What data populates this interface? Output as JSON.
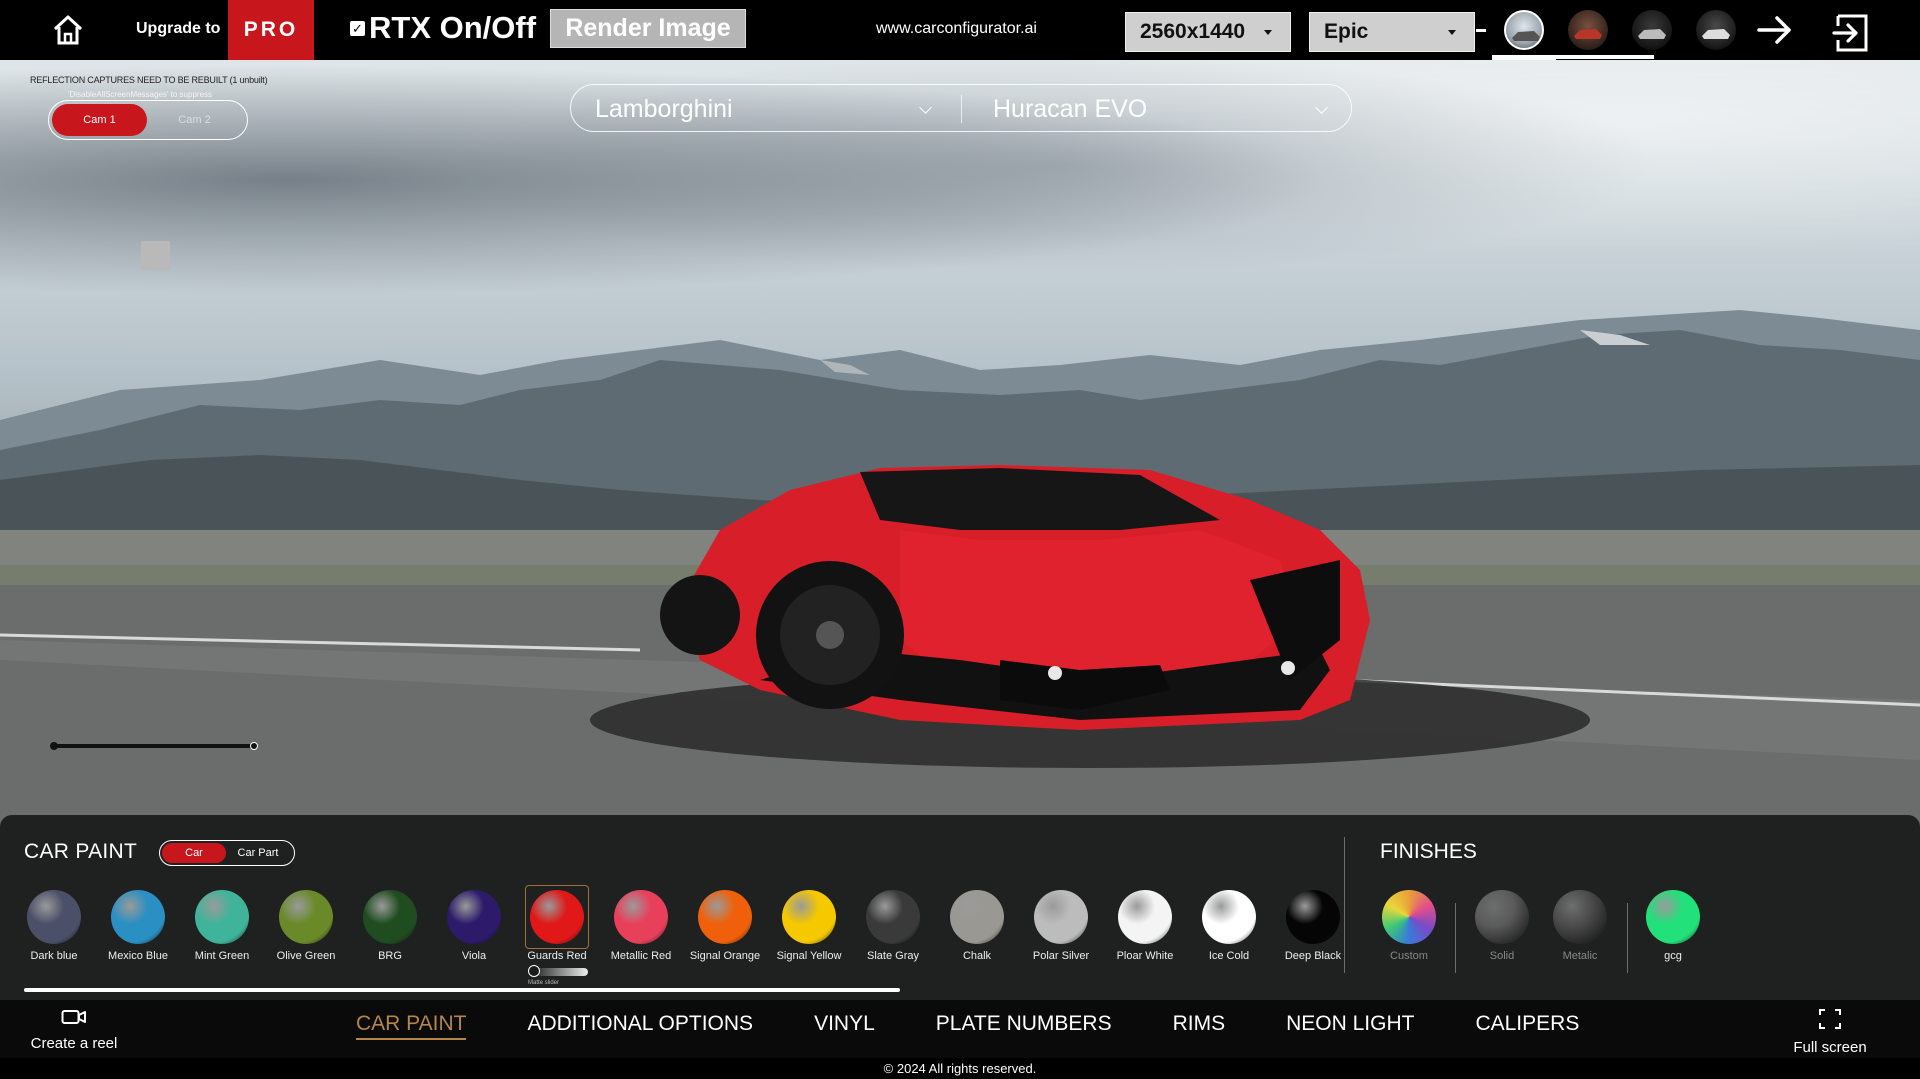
{
  "topbar": {
    "upgrade_label": "Upgrade to",
    "pro_label": "PRO",
    "rtx_label": "RTX On/Off",
    "rtx_checked": true,
    "render_label": "Render Image",
    "site_url": "www.carconfigurator.ai",
    "resolution_value": "2560x1440",
    "quality_value": "Epic"
  },
  "viewport": {
    "reflection_message": "REFLECTION CAPTURES NEED TO BE REBUILT (1 unbuilt)",
    "reflection_sub": "'DisableAllScreenMessages' to suppress",
    "cam_1_label": "Cam 1",
    "cam_2_label": "Cam 2",
    "brand_value": "Lamborghini",
    "model_value": "Huracan EVO"
  },
  "panel": {
    "title": "CAR PAINT",
    "toggle_car": "Car",
    "toggle_part": "Car Part",
    "finishes_title": "FINISHES",
    "matte_label": "Matte slider",
    "colors": [
      {
        "name": "Dark blue",
        "color": "#4a5068"
      },
      {
        "name": "Mexico Blue",
        "color": "#2a8fc2"
      },
      {
        "name": "Mint Green",
        "color": "#3fb49a"
      },
      {
        "name": "Olive Green",
        "color": "#6a8a2a"
      },
      {
        "name": "BRG",
        "color": "#1f4d1f"
      },
      {
        "name": "Viola",
        "color": "#2d1a6a"
      },
      {
        "name": "Guards Red",
        "color": "#e01818"
      },
      {
        "name": "Metallic Red",
        "color": "#e8405a"
      },
      {
        "name": "Signal Orange",
        "color": "#f0600a"
      },
      {
        "name": "Signal Yellow",
        "color": "#f5c800"
      },
      {
        "name": "Slate Gray",
        "color": "#3a3a3a"
      },
      {
        "name": "Chalk",
        "color": "#9a9892"
      },
      {
        "name": "Polar Silver",
        "color": "#bcbcbc"
      },
      {
        "name": "Ploar White",
        "color": "#f4f4f4"
      },
      {
        "name": "Ice Cold",
        "color": "#ffffff"
      },
      {
        "name": "Deep Black",
        "color": "#050505"
      }
    ],
    "finishes": [
      {
        "name": "Custom"
      },
      {
        "name": "Solid",
        "color": "#5a5a5a"
      },
      {
        "name": "Metalic",
        "color": "#4a4a4a"
      }
    ],
    "custom_color": {
      "name": "gcg",
      "color": "#22e07a"
    }
  },
  "nav": {
    "reel_label": "Create a reel",
    "tabs": [
      "CAR PAINT",
      "ADDITIONAL OPTIONS",
      "VINYL",
      "PLATE NUMBERS",
      "RIMS",
      "NEON LIGHT",
      "CALIPERS"
    ],
    "active_tab": 0,
    "fullscreen_label": "Full screen"
  },
  "footer": {
    "copyright": "© 2024 All rights reserved."
  },
  "colors": {
    "accent_red": "#c8161d",
    "active_tab": "#b5854b"
  }
}
